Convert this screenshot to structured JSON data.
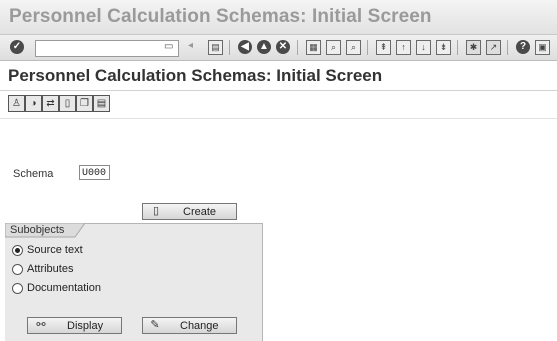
{
  "window": {
    "title": "Personnel Calculation Schemas: Initial Screen"
  },
  "system_toolbar": {
    "command_field": {
      "value": ""
    },
    "icons": [
      "enter-icon",
      "save-icon",
      "back-icon",
      "exit-icon",
      "cancel-icon",
      "print-icon",
      "find-icon",
      "find-next-icon",
      "first-page-icon",
      "previous-page-icon",
      "next-page-icon",
      "last-page-icon",
      "new-session-icon",
      "shortcut-icon",
      "help-icon",
      "customize-layout-icon"
    ]
  },
  "screen": {
    "title": "Personnel Calculation Schemas: Initial Screen"
  },
  "app_toolbar": {
    "icons": [
      "user-icon",
      "globe-icon",
      "transport-icon",
      "delete-icon",
      "copy-icon",
      "document-icon"
    ]
  },
  "schema": {
    "label": "Schema",
    "value": "U000"
  },
  "create_button": {
    "label": "Create"
  },
  "subobjects": {
    "title": "Subobjects",
    "options": [
      {
        "label": "Source text",
        "selected": true
      },
      {
        "label": "Attributes",
        "selected": false
      },
      {
        "label": "Documentation",
        "selected": false
      }
    ]
  },
  "display_button": {
    "label": "Display"
  },
  "change_button": {
    "label": "Change"
  }
}
